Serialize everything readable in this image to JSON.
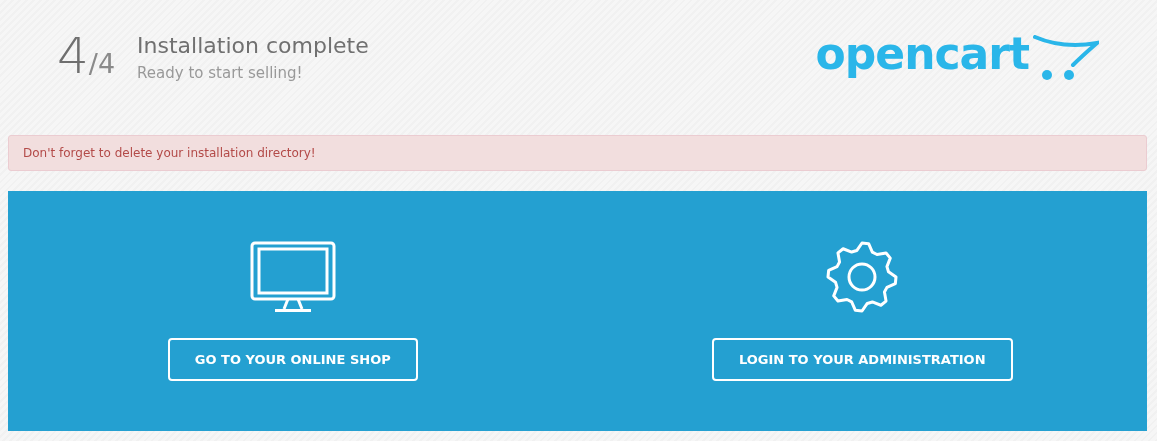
{
  "header": {
    "step_current": "4",
    "step_total": "/4",
    "title": "Installation complete",
    "subtitle": "Ready to start selling!",
    "logo": "opencart"
  },
  "alert": "Don't forget to delete your installation directory!",
  "actions": [
    {
      "kind": "monitor",
      "label": "GO TO YOUR ONLINE SHOP"
    },
    {
      "kind": "gear",
      "label": "LOGIN TO YOUR ADMINISTRATION"
    }
  ]
}
